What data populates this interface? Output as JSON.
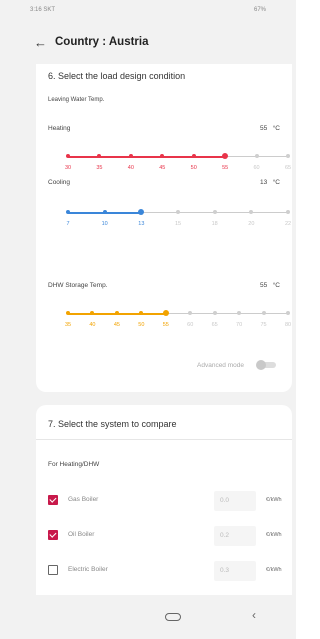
{
  "status_bar": {
    "left": "3:16 SKT",
    "right": "67%"
  },
  "app_bar": {
    "back_icon": "arrow-left-icon",
    "title": "Country : Austria"
  },
  "section6": {
    "title": "6. Select the load design condition",
    "subtitle": "Leaving Water Temp.",
    "sliders": [
      {
        "label": "Heating",
        "value": "55",
        "unit": "°C",
        "color": "#e8344a",
        "ticks": [
          "30",
          "35",
          "40",
          "45",
          "50",
          "55",
          "60",
          "65"
        ],
        "selected_index": 5
      },
      {
        "label": "Cooling",
        "value": "13",
        "unit": "°C",
        "color": "#3a86d9",
        "ticks": [
          "7",
          "10",
          "13",
          "15",
          "18",
          "20",
          "22"
        ],
        "selected_index": 2
      },
      {
        "label": "DHW Storage Temp.",
        "value": "55",
        "unit": "°C",
        "color": "#f2a300",
        "ticks": [
          "35",
          "40",
          "45",
          "50",
          "55",
          "60",
          "65",
          "70",
          "75",
          "80"
        ],
        "selected_index": 4
      }
    ],
    "advanced_mode": {
      "label": "Advanced mode",
      "enabled": false
    }
  },
  "section7": {
    "title": "7. Select the system to compare",
    "subtitle": "For Heating/DHW",
    "rows": [
      {
        "label": "Gas Boiler",
        "checked": true,
        "value": "0.0",
        "unit": "€/kWh"
      },
      {
        "label": "Oil Boiler",
        "checked": true,
        "value": "0.2",
        "unit": "€/kWh"
      },
      {
        "label": "Electric Boiler",
        "checked": false,
        "value": "0.3",
        "unit": "€/kWh"
      }
    ]
  },
  "nav_bar": {
    "home_icon": "home-pill-icon",
    "back_icon": "back-chevron-icon"
  }
}
